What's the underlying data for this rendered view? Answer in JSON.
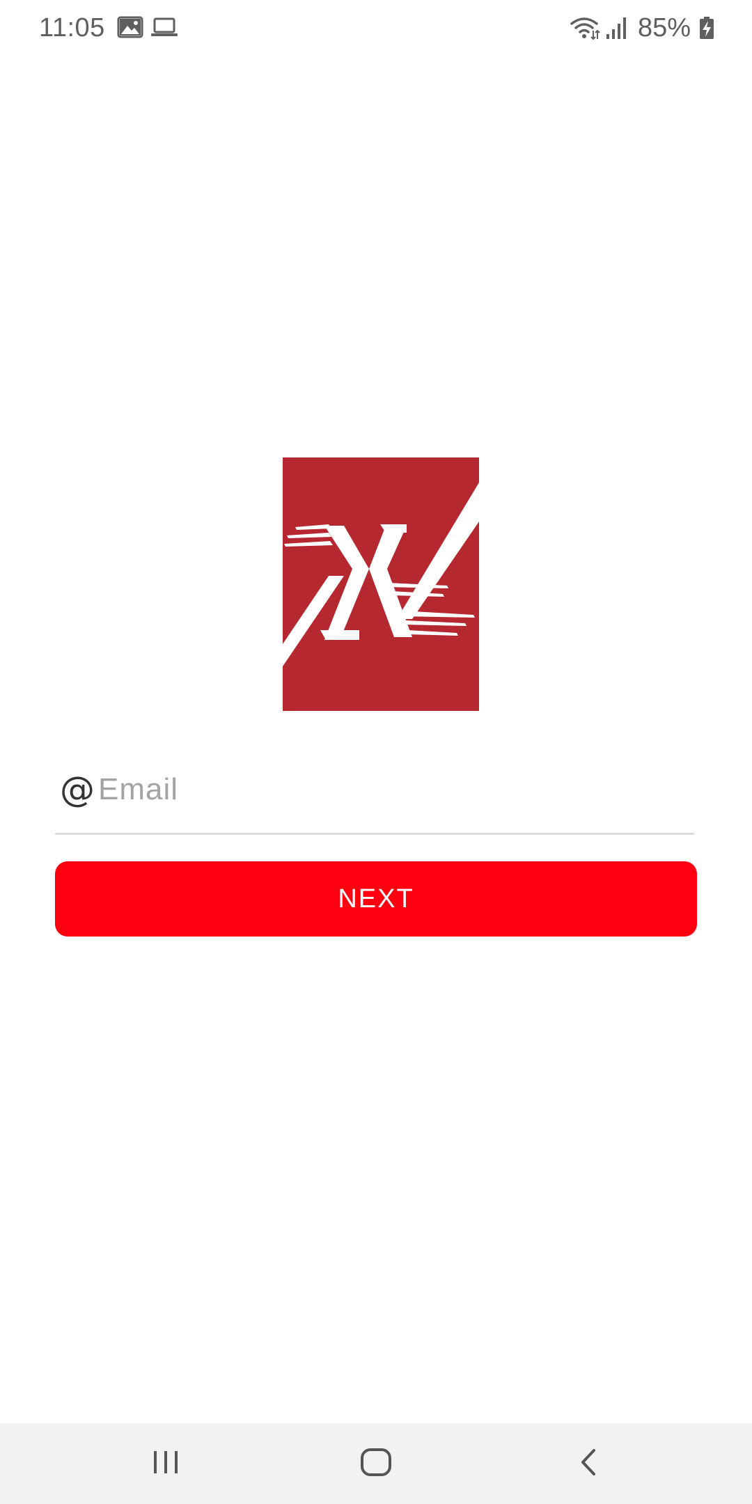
{
  "status_bar": {
    "time": "11:05",
    "battery": "85%",
    "icons": [
      "gallery-icon",
      "laptop-icon",
      "wifi-icon",
      "signal-icon",
      "battery-charging-icon"
    ]
  },
  "logo": {
    "icon": "brand-logo",
    "background_color": "#b52830",
    "mark_color": "#ffffff"
  },
  "email_field": {
    "icon": "at-icon",
    "icon_glyph": "@",
    "placeholder": "Email",
    "value": ""
  },
  "next_button": {
    "label": "NEXT",
    "color": "#ff0011"
  },
  "nav_bar": {
    "buttons": [
      "recents-icon",
      "home-icon",
      "back-icon"
    ]
  }
}
